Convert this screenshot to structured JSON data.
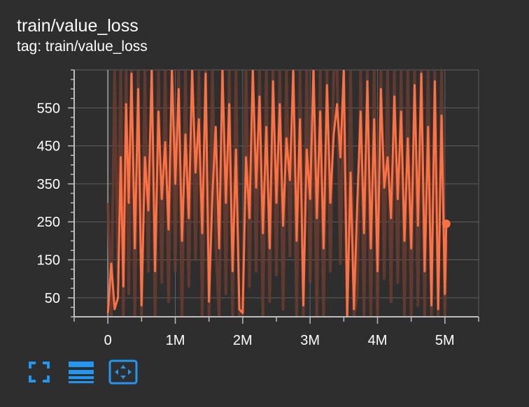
{
  "card": {
    "title": "train/value_loss",
    "tag": "tag: train/value_loss"
  },
  "colors": {
    "background": "#2e2e2e",
    "smoothed_line": "#ff7043",
    "raw_line": "#6b3b2e",
    "grid": "#5f5f5f",
    "axis": "#bdbdbd",
    "toolbar_icon": "#2196f3"
  },
  "toolbar": {
    "icons": [
      "fullscreen-icon",
      "toggle-log-scale-icon",
      "fit-domain-icon"
    ]
  },
  "chart_data": {
    "type": "line",
    "title": "",
    "xlabel": "",
    "ylabel": "",
    "xlim": [
      -500000,
      5500000
    ],
    "ylim": [
      0,
      650
    ],
    "x_ticks": [
      0,
      1000000,
      2000000,
      3000000,
      4000000,
      5000000
    ],
    "x_tick_labels": [
      "0",
      "1M",
      "2M",
      "3M",
      "4M",
      "5M"
    ],
    "y_ticks": [
      50,
      150,
      250,
      350,
      450,
      550
    ],
    "y_tick_labels": [
      "50",
      "150",
      "250",
      "350",
      "450",
      "550"
    ],
    "grid": true,
    "legend": "none",
    "series": [
      {
        "style": "smoothed",
        "x": [
          0,
          50000,
          100000,
          150000,
          190000,
          230000,
          270000,
          310000,
          350000,
          400000,
          450000,
          500000,
          550000,
          600000,
          650000,
          700000,
          750000,
          800000,
          850000,
          900000,
          950000,
          1000000,
          1050000,
          1100000,
          1150000,
          1200000,
          1250000,
          1300000,
          1350000,
          1400000,
          1450000,
          1500000,
          1550000,
          1600000,
          1650000,
          1700000,
          1750000,
          1800000,
          1850000,
          1900000,
          1950000,
          2000000,
          2050000,
          2100000,
          2150000,
          2200000,
          2250000,
          2300000,
          2350000,
          2400000,
          2450000,
          2500000,
          2550000,
          2600000,
          2650000,
          2700000,
          2750000,
          2800000,
          2850000,
          2900000,
          2950000,
          3000000,
          3050000,
          3100000,
          3150000,
          3200000,
          3250000,
          3300000,
          3350000,
          3400000,
          3450000,
          3500000,
          3550000,
          3600000,
          3650000,
          3700000,
          3750000,
          3800000,
          3850000,
          3900000,
          3950000,
          4000000,
          4050000,
          4100000,
          4150000,
          4200000,
          4250000,
          4300000,
          4350000,
          4400000,
          4450000,
          4500000,
          4550000,
          4600000,
          4650000,
          4700000,
          4750000,
          4800000,
          4850000,
          4900000,
          4950000,
          5000000,
          5020000
        ],
        "y": [
          10,
          140,
          20,
          50,
          420,
          80,
          560,
          300,
          640,
          180,
          600,
          30,
          420,
          280,
          650,
          120,
          540,
          310,
          460,
          230,
          650,
          350,
          600,
          200,
          480,
          260,
          650,
          380,
          520,
          220,
          640,
          40,
          320,
          500,
          180,
          650,
          300,
          560,
          120,
          440,
          20,
          10,
          420,
          260,
          650,
          340,
          580,
          220,
          500,
          180,
          620,
          300,
          560,
          240,
          470,
          360,
          650,
          200,
          520,
          30,
          440,
          310,
          650,
          260,
          540,
          180,
          610,
          300,
          480,
          560,
          420,
          650,
          0,
          380,
          20,
          300,
          540,
          220,
          620,
          180,
          520,
          120,
          600,
          340,
          420,
          260,
          580,
          310,
          540,
          200,
          470,
          180,
          610,
          240,
          640,
          120,
          500,
          30,
          620,
          20,
          530,
          60,
          245
        ]
      },
      {
        "style": "raw",
        "x": [
          0,
          50000,
          100000,
          150000,
          190000,
          230000,
          270000,
          310000,
          350000,
          400000,
          450000,
          500000,
          550000,
          600000,
          650000,
          700000,
          750000,
          800000,
          850000,
          900000,
          950000,
          1000000,
          1050000,
          1100000,
          1150000,
          1200000,
          1250000,
          1300000,
          1350000,
          1400000,
          1450000,
          1500000,
          1550000,
          1600000,
          1650000,
          1700000,
          1750000,
          1800000,
          1850000,
          1900000,
          1950000,
          2000000,
          2050000,
          2100000,
          2150000,
          2200000,
          2250000,
          2300000,
          2350000,
          2400000,
          2450000,
          2500000,
          2550000,
          2600000,
          2650000,
          2700000,
          2750000,
          2800000,
          2850000,
          2900000,
          2950000,
          3000000,
          3050000,
          3100000,
          3150000,
          3200000,
          3250000,
          3300000,
          3350000,
          3400000,
          3450000,
          3500000,
          3550000,
          3600000,
          3650000,
          3700000,
          3750000,
          3800000,
          3850000,
          3900000,
          3950000,
          4000000,
          4050000,
          4100000,
          4150000,
          4200000,
          4250000,
          4300000,
          4350000,
          4400000,
          4450000,
          4500000,
          4550000,
          4600000,
          4650000,
          4700000,
          4750000,
          4800000,
          4850000,
          4900000,
          4950000,
          5000000,
          5020000
        ],
        "y": [
          300,
          0,
          650,
          100,
          650,
          0,
          650,
          60,
          650,
          0,
          650,
          0,
          650,
          120,
          650,
          0,
          650,
          90,
          650,
          40,
          650,
          120,
          650,
          0,
          650,
          80,
          650,
          150,
          650,
          0,
          650,
          0,
          650,
          200,
          0,
          650,
          60,
          650,
          0,
          650,
          0,
          0,
          650,
          80,
          650,
          120,
          650,
          0,
          650,
          40,
          650,
          110,
          650,
          20,
          650,
          160,
          650,
          0,
          650,
          0,
          650,
          90,
          650,
          0,
          650,
          0,
          650,
          120,
          650,
          650,
          140,
          650,
          0,
          650,
          0,
          60,
          650,
          0,
          650,
          0,
          650,
          0,
          650,
          100,
          650,
          40,
          650,
          90,
          650,
          0,
          650,
          0,
          650,
          30,
          650,
          0,
          650,
          0,
          650,
          0,
          650,
          0,
          200
        ]
      }
    ],
    "current_point": {
      "x": 5020000,
      "y": 245
    }
  }
}
